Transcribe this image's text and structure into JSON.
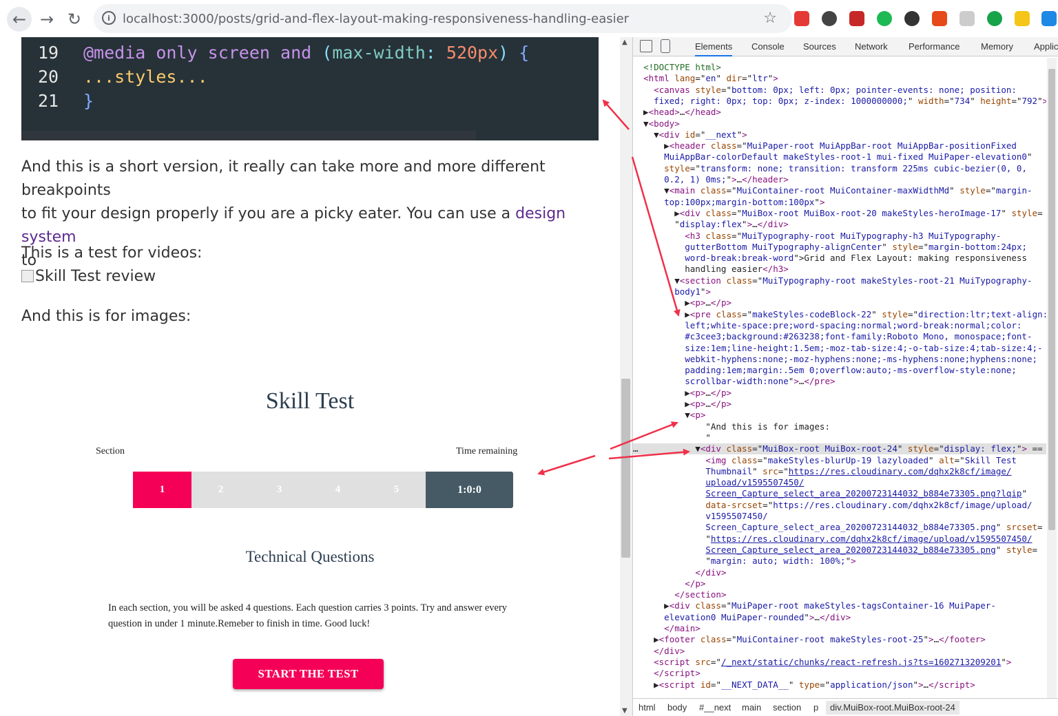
{
  "browser": {
    "url": "localhost:3000/posts/grid-and-flex-layout-making-responsiveness-handling-easier",
    "nav_back": "←",
    "nav_forward": "→",
    "nav_reload": "↻",
    "info_icon": "i",
    "star": "☆",
    "extension_colors": [
      "#e53935",
      "#444444",
      "#c62828",
      "#1db954",
      "#333333",
      "#e64a19",
      "#cccccc",
      "#16a34a",
      "#f5c518",
      "#1e88e5"
    ]
  },
  "page": {
    "code": {
      "lines": [
        {
          "n": "19",
          "tokens": [
            {
              "t": "@media",
              "c": "at"
            },
            {
              "t": " "
            },
            {
              "t": "only",
              "c": "kw"
            },
            {
              "t": " "
            },
            {
              "t": "screen",
              "c": "kw"
            },
            {
              "t": " "
            },
            {
              "t": "and",
              "c": "kw"
            },
            {
              "t": " "
            },
            {
              "t": "(",
              "c": "par"
            },
            {
              "t": "max-width",
              "c": "prop"
            },
            {
              "t": ": ",
              "c": "par"
            },
            {
              "t": "520px",
              "c": "num"
            },
            {
              "t": ")",
              "c": "par"
            },
            {
              "t": " "
            },
            {
              "t": "{",
              "c": "brace"
            }
          ]
        },
        {
          "n": "20",
          "tokens": [
            {
              "t": "...styles...",
              "c": "sty"
            }
          ]
        },
        {
          "n": "21",
          "tokens": [
            {
              "t": "}",
              "c": "brace"
            }
          ]
        }
      ]
    },
    "para1_line1": "And this is a short version, it really can take more and more different breakpoints",
    "para1_line2_a": "to fit your design properly if you are a picky eater. You can use a ",
    "para1_link": "design system",
    "para1_line3": "to",
    "videos_text": "This is a test for videos:",
    "broken_img_alt": "Skill Test review",
    "images_text": "And this is for images:",
    "skill": {
      "title": "Skill Test",
      "section_label": "Section",
      "time_label": "Time remaining",
      "sections": [
        "1",
        "2",
        "3",
        "4",
        "5"
      ],
      "active_section": 1,
      "timer": "1:0:0",
      "subtitle": "Technical Questions",
      "description": "In each section, you will be asked 4 questions. Each question carries 3 points. Try and answer every question in under 1 minute.Remeber to finish in time. Good luck!",
      "start_button": "START THE TEST"
    }
  },
  "devtools": {
    "tabs": [
      "Elements",
      "Console",
      "Sources",
      "Network",
      "Performance",
      "Memory",
      "Applic"
    ],
    "active_tab": "Elements",
    "dom_lines": [
      "<span class='cm'>&lt;!DOCTYPE html&gt;</span>",
      "<span class='tg'>&lt;html</span> <span class='at'>lang</span>=\"<span class='av'>en</span>\" <span class='at'>dir</span>=\"<span class='av'>ltr</span>\"<span class='tg'>&gt;</span>",
      "  <span class='tg'>&lt;canvas</span> <span class='at'>style</span>=\"<span class='av'>bottom: 0px; left: 0px; pointer-events: none; position:</span>",
      "  <span class='av'>fixed; right: 0px; top: 0px; z-index: 1000000000;</span>\" <span class='at'>width</span>=\"<span class='av'>734</span>\" <span class='at'>height</span>=\"<span class='av'>792</span>\"<span class='tg'>&gt;</span>",
      "▶<span class='tg'>&lt;head&gt;</span>…<span class='tg'>&lt;/head&gt;</span>",
      "▼<span class='tg'>&lt;body&gt;</span>",
      "  ▼<span class='tg'>&lt;div</span> <span class='at'>id</span>=\"<span class='av'>__next</span>\"<span class='tg'>&gt;</span>",
      "    ▶<span class='tg'>&lt;header</span> <span class='at'>class</span>=\"<span class='av'>MuiPaper-root MuiAppBar-root MuiAppBar-positionFixed</span>",
      "    <span class='av'>MuiAppBar-colorDefault makeStyles-root-1 mui-fixed MuiPaper-elevation0</span>\"",
      "    <span class='at'>style</span>=\"<span class='av'>transform: none; transition: transform 225ms cubic-bezier(0, 0,</span>",
      "    <span class='av'>0.2, 1) 0ms;</span>\"<span class='tg'>&gt;</span>…<span class='tg'>&lt;/header&gt;</span>",
      "    ▼<span class='tg'>&lt;main</span> <span class='at'>class</span>=\"<span class='av'>MuiContainer-root MuiContainer-maxWidthMd</span>\" <span class='at'>style</span>=\"<span class='av'>margin-</span>",
      "    <span class='av'>top:100px;margin-bottom:100px</span>\"<span class='tg'>&gt;</span>",
      "      ▶<span class='tg'>&lt;div</span> <span class='at'>class</span>=\"<span class='av'>MuiBox-root MuiBox-root-20 makeStyles-heroImage-17</span>\" <span class='at'>style</span>=",
      "      \"<span class='av'>display:flex</span>\"<span class='tg'>&gt;</span>…<span class='tg'>&lt;/div&gt;</span>",
      "        <span class='tg'>&lt;h3</span> <span class='at'>class</span>=\"<span class='av'>MuiTypography-root MuiTypography-h3 MuiTypography-</span>",
      "        <span class='av'>gutterBottom MuiTypography-alignCenter</span>\" <span class='at'>style</span>=\"<span class='av'>margin-bottom:24px;</span>",
      "        <span class='av'>word-break:break-word</span>\"&gt;Grid and Flex Layout: making responsiveness",
      "        handling easier<span class='tg'>&lt;/h3&gt;</span>",
      "      ▼<span class='tg'>&lt;section</span> <span class='at'>class</span>=\"<span class='av'>MuiTypography-root makeStyles-root-21 MuiTypography-</span>",
      "      <span class='av'>body1</span>\"<span class='tg'>&gt;</span>",
      "        ▶<span class='tg'>&lt;p&gt;</span>…<span class='tg'>&lt;/p&gt;</span>",
      "        ▶<span class='tg'>&lt;pre</span> <span class='at'>class</span>=\"<span class='av'>makeStyles-codeBlock-22</span>\" <span class='at'>style</span>=\"<span class='av'>direction:ltr;text-align:</span>",
      "        <span class='av'>left;white-space:pre;word-spacing:normal;word-break:normal;color:</span>",
      "        <span class='av'>#c3cee3;background:#263238;font-family:Roboto Mono, monospace;font-</span>",
      "        <span class='av'>size:1em;line-height:1.5em;-moz-tab-size:4;-o-tab-size:4;tab-size:4;-</span>",
      "        <span class='av'>webkit-hyphens:none;-moz-hyphens:none;-ms-hyphens:none;hyphens:none;</span>",
      "        <span class='av'>padding:1em;margin:.5em 0;overflow:auto;-ms-overflow-style:none;</span>",
      "        <span class='av'>scrollbar-width:none</span>\"<span class='tg'>&gt;</span>…<span class='tg'>&lt;/pre&gt;</span>",
      "        ▶<span class='tg'>&lt;p&gt;</span>…<span class='tg'>&lt;/p&gt;</span>",
      "        ▶<span class='tg'>&lt;p&gt;</span>…<span class='tg'>&lt;/p&gt;</span>",
      "        ▼<span class='tg'>&lt;p&gt;</span>",
      "            \"And this is for images:",
      "            \"",
      "          ▼<span class='tg'>&lt;div</span> <span class='at'>class</span>=\"<span class='av'>MuiBox-root MuiBox-root-24</span>\" <span class='at'>style</span>=\"<span class='av'>display: flex;</span>\"<span class='tg'>&gt;</span> == $",
      "            <span class='tg'>&lt;img</span> <span class='at'>class</span>=\"<span class='av'>makeStyles-blurUp-19 lazyloaded</span>\" <span class='at'>alt</span>=\"<span class='av'>Skill Test</span>",
      "            <span class='av'>Thumbnail</span>\" <span class='at'>src</span>=\"<span class='lk'>https://res.cloudinary.com/dqhx2k8cf/image/</span>",
      "            <span class='lk'>upload/v1595507450/</span>",
      "            <span class='lk'>Screen_Capture_select_area_20200723144032_b884e73305.png?lqip</span>\"",
      "            <span class='at'>data-srcset</span>=\"<span class='av'>https://res.cloudinary.com/dqhx2k8cf/image/upload/</span>",
      "            <span class='av'>v1595507450/</span>",
      "            <span class='av'>Screen_Capture_select_area_20200723144032_b884e73305.png</span>\" <span class='at'>srcset</span>=",
      "            \"<span class='lk'>https://res.cloudinary.com/dqhx2k8cf/image/upload/v1595507450/</span>",
      "            <span class='lk'>Screen_Capture_select_area_20200723144032_b884e73305.png</span>\" <span class='at'>style</span>=",
      "            \"<span class='av'>margin: auto; width: 100%;</span>\"<span class='tg'>&gt;</span>",
      "          <span class='tg'>&lt;/div&gt;</span>",
      "        <span class='tg'>&lt;/p&gt;</span>",
      "      <span class='tg'>&lt;/section&gt;</span>",
      "    ▶<span class='tg'>&lt;div</span> <span class='at'>class</span>=\"<span class='av'>MuiPaper-root makeStyles-tagsContainer-16 MuiPaper-</span>",
      "    <span class='av'>elevation0 MuiPaper-rounded</span>\"<span class='tg'>&gt;</span>…<span class='tg'>&lt;/div&gt;</span>",
      "    <span class='tg'>&lt;/main&gt;</span>",
      "  ▶<span class='tg'>&lt;footer</span> <span class='at'>class</span>=\"<span class='av'>MuiContainer-root makeStyles-root-25</span>\"<span class='tg'>&gt;</span>…<span class='tg'>&lt;/footer&gt;</span>",
      "  <span class='tg'>&lt;/div&gt;</span>",
      "  <span class='tg'>&lt;script</span> <span class='at'>src</span>=\"<span class='lk'>/_next/static/chunks/react-refresh.js?ts=1602713209201</span>\"<span class='tg'>&gt;</span>",
      "  <span class='tg'>&lt;/script&gt;</span>",
      "  ▶<span class='tg'>&lt;script</span> <span class='at'>id</span>=\"<span class='av'>__NEXT_DATA__</span>\" <span class='at'>type</span>=\"<span class='av'>application/json</span>\"<span class='tg'>&gt;</span>…<span class='tg'>&lt;/script&gt;</span>"
    ],
    "highlighted_index": 34,
    "ellipsis": "…",
    "breadcrumbs": [
      "html",
      "body",
      "#__next",
      "main",
      "section",
      "p",
      "div.MuiBox-root.MuiBox-root-24"
    ]
  },
  "annotation_color": "#f0304a"
}
